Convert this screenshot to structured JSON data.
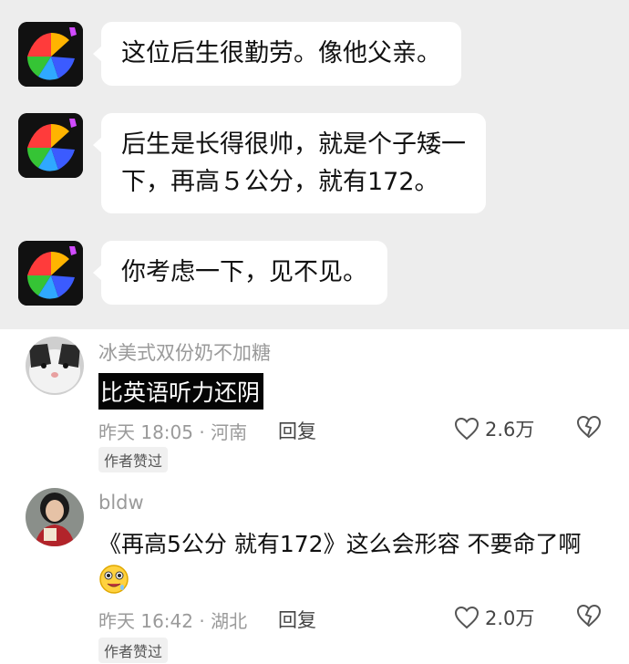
{
  "chat": {
    "messages": [
      {
        "lines": [
          "这位后生很勤劳。像他父亲。"
        ]
      },
      {
        "lines": [
          "后生是长得很帅，就是个子矮一",
          "下，再高５公分，就有172。"
        ]
      },
      {
        "lines": [
          "你考虑一下，见不见。"
        ]
      }
    ]
  },
  "comments": [
    {
      "username": "冰美式双份奶不加糖",
      "text": "比英语听力还阴",
      "meta": "昨天 18:05 · 河南",
      "reply_label": "回复",
      "likes": "2.6万",
      "badge": "作者赞过",
      "avatar_icon": "cat-avatar-icon"
    },
    {
      "username": "bldw",
      "text": "《再高5公分 就有172》这么会形容 不要命了啊",
      "emoji_icon": "drooling-face-emoji-icon",
      "meta": "昨天 16:42 · 湖北",
      "reply_label": "回复",
      "likes": "2.0万",
      "badge": "作者赞过",
      "avatar_icon": "person-avatar-icon"
    }
  ],
  "colors": {
    "chat_background": "#ededed",
    "bubble": "#ffffff",
    "highlight_bg": "#050505",
    "muted_text": "#9a9a9a"
  }
}
